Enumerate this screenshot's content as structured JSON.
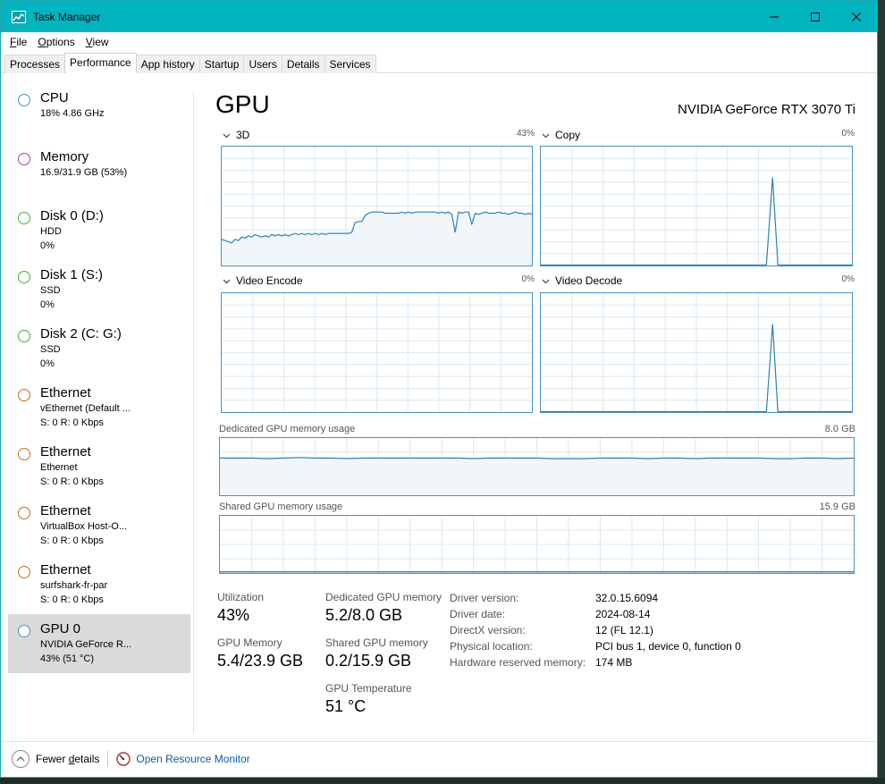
{
  "window": {
    "title": "Task Manager"
  },
  "menu": [
    {
      "label": "File",
      "accel": "F",
      "rest": "ile"
    },
    {
      "label": "Options",
      "accel": "O",
      "rest": "ptions"
    },
    {
      "label": "View",
      "accel": "V",
      "rest": "iew"
    }
  ],
  "tabs": [
    "Processes",
    "Performance",
    "App history",
    "Startup",
    "Users",
    "Details",
    "Services"
  ],
  "active_tab": "Performance",
  "sidebar": [
    {
      "title": "CPU",
      "lines": [
        "18%  4.86 GHz"
      ],
      "color": "#4a90c2"
    },
    {
      "title": "Memory",
      "lines": [
        "16.9/31.9 GB (53%)"
      ],
      "color": "#a33fb5"
    },
    {
      "title": "Disk 0 (D:)",
      "lines": [
        "HDD",
        "0%"
      ],
      "color": "#4ea83a"
    },
    {
      "title": "Disk 1 (S:)",
      "lines": [
        "SSD",
        "0%"
      ],
      "color": "#4ea83a"
    },
    {
      "title": "Disk 2 (C: G:)",
      "lines": [
        "SSD",
        "0%"
      ],
      "color": "#4ea83a"
    },
    {
      "title": "Ethernet",
      "lines": [
        "vEthernet (Default ...",
        "S: 0  R: 0 Kbps"
      ],
      "color": "#c56a2a"
    },
    {
      "title": "Ethernet",
      "lines": [
        "Ethernet",
        "S: 0  R: 0 Kbps"
      ],
      "color": "#c56a2a"
    },
    {
      "title": "Ethernet",
      "lines": [
        "VirtualBox Host-O...",
        "S: 0  R: 0 Kbps"
      ],
      "color": "#c56a2a"
    },
    {
      "title": "Ethernet",
      "lines": [
        "surfshark-fr-par",
        "S: 0  R: 0 Kbps"
      ],
      "color": "#c56a2a"
    },
    {
      "title": "GPU 0",
      "lines": [
        "NVIDIA GeForce R...",
        "43%  (51 °C)"
      ],
      "color": "#4a90c2"
    }
  ],
  "main": {
    "title": "GPU",
    "model": "NVIDIA GeForce RTX 3070 Ti",
    "graphs": {
      "g3d": {
        "label": "3D",
        "pct": "43%"
      },
      "copy": {
        "label": "Copy",
        "pct": "0%"
      },
      "encode": {
        "label": "Video Encode",
        "pct": "0%"
      },
      "decode": {
        "label": "Video Decode",
        "pct": "0%"
      }
    },
    "dedicated": {
      "label": "Dedicated GPU memory usage",
      "max": "8.0 GB"
    },
    "shared": {
      "label": "Shared GPU memory usage",
      "max": "15.9 GB"
    }
  },
  "stats": {
    "utilization": {
      "label": "Utilization",
      "value": "43%"
    },
    "dedicated_mem": {
      "label": "Dedicated GPU memory",
      "value": "5.2/8.0 GB"
    },
    "gpu_memory": {
      "label": "GPU Memory",
      "value": "5.4/23.9 GB"
    },
    "shared_mem": {
      "label": "Shared GPU memory",
      "value": "0.2/15.9 GB"
    },
    "temperature": {
      "label": "GPU Temperature",
      "value": "51 °C"
    }
  },
  "info": [
    {
      "key": "Driver version:",
      "val": "32.0.15.6094"
    },
    {
      "key": "Driver date:",
      "val": "2024-08-14"
    },
    {
      "key": "DirectX version:",
      "val": "12 (FL 12.1)"
    },
    {
      "key": "Physical location:",
      "val": "PCI bus 1, device 0, function 0"
    },
    {
      "key": "Hardware reserved memory:",
      "val": "174 MB"
    }
  ],
  "footer": {
    "fewer_details": "Fewer details",
    "fewer_accel": "d",
    "open_monitor": "Open Resource Monitor"
  },
  "series": {
    "g3d": [
      0.22,
      0.21,
      0.2,
      0.19,
      0.22,
      0.21,
      0.24,
      0.23,
      0.25,
      0.24,
      0.26,
      0.25,
      0.24,
      0.25,
      0.24,
      0.26,
      0.25,
      0.26,
      0.25,
      0.26,
      0.25,
      0.26,
      0.27,
      0.26,
      0.27,
      0.26,
      0.27,
      0.26,
      0.27,
      0.26,
      0.27,
      0.26,
      0.27,
      0.27,
      0.27,
      0.27,
      0.27,
      0.27,
      0.27,
      0.28,
      0.36,
      0.37,
      0.37,
      0.42,
      0.44,
      0.45,
      0.45,
      0.45,
      0.45,
      0.44,
      0.44,
      0.44,
      0.44,
      0.44,
      0.45,
      0.44,
      0.45,
      0.44,
      0.45,
      0.45,
      0.45,
      0.45,
      0.45,
      0.45,
      0.45,
      0.44,
      0.45,
      0.44,
      0.45,
      0.43,
      0.28,
      0.45,
      0.44,
      0.45,
      0.45,
      0.35,
      0.44,
      0.43,
      0.44,
      0.45,
      0.44,
      0.44,
      0.44,
      0.45,
      0.44,
      0.44,
      0.43,
      0.44,
      0.45,
      0.44,
      0.44,
      0.43,
      0.44,
      0.43
    ],
    "copy_spike": 0.74,
    "decode_spike": 0.74,
    "dedicated": [
      0.65,
      0.65,
      0.65,
      0.64,
      0.65,
      0.66,
      0.65,
      0.65,
      0.64,
      0.65,
      0.65,
      0.65,
      0.65,
      0.65,
      0.65,
      0.65,
      0.64,
      0.65,
      0.65,
      0.65,
      0.65,
      0.64,
      0.64,
      0.64,
      0.65,
      0.65,
      0.65,
      0.64,
      0.65,
      0.65,
      0.64,
      0.65,
      0.65,
      0.65,
      0.65,
      0.64,
      0.64,
      0.65,
      0.65,
      0.64,
      0.65
    ],
    "shared": 0.02
  }
}
